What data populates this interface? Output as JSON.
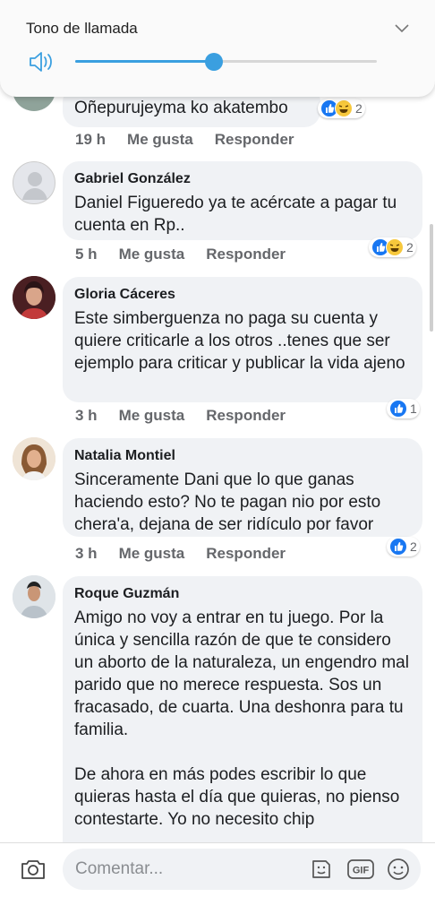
{
  "volume_panel": {
    "title": "Tono de llamada",
    "level_percent": 46
  },
  "comments": [
    {
      "author": "",
      "text": "Oñepurujeyma ko akatembo",
      "time": "19 h",
      "like_label": "Me gusta",
      "reply_label": "Responder",
      "reactions": [
        "like",
        "haha"
      ],
      "reaction_count": "2"
    },
    {
      "author": "Gabriel González",
      "text": "Daniel Figueredo ya te acércate a pagar tu cuenta en Rp..",
      "time": "5 h",
      "like_label": "Me gusta",
      "reply_label": "Responder",
      "reactions": [
        "like",
        "haha"
      ],
      "reaction_count": "2"
    },
    {
      "author": "Gloria Cáceres",
      "text": "Este simberguenza no paga su cuenta y quiere criticarle a los otros ..tenes que ser ejemplo para criticar y publicar la vida ajeno",
      "time": "3 h",
      "like_label": "Me gusta",
      "reply_label": "Responder",
      "reactions": [
        "like"
      ],
      "reaction_count": "1"
    },
    {
      "author": "Natalia Montiel",
      "text": "Sinceramente Dani que lo que ganas haciendo esto? No te pagan nio por esto chera'a, dejana de ser ridículo por favor",
      "time": "3 h",
      "like_label": "Me gusta",
      "reply_label": "Responder",
      "reactions": [
        "like"
      ],
      "reaction_count": "2"
    },
    {
      "author": "Roque Guzmán",
      "text": "Amigo no voy a entrar en tu juego. Por la única y sencilla razón de que te considero un aborto de la naturaleza, un engendro mal parido que no merece respuesta. Sos un fracasado, de cuarta. Una deshonra para tu familia.\n\nDe ahora en más podes escribir lo que quieras hasta el día que quieras, no pienso contestarte.  Yo no necesito chip"
    }
  ],
  "composer": {
    "placeholder": "Comentar...",
    "icons": [
      "camera-icon",
      "sticker-icon",
      "gif-icon",
      "emoji-icon"
    ],
    "gif_label": "GIF"
  },
  "colors": {
    "accent": "#3a9fe0",
    "like": "#1877f2",
    "bubble": "#f0f2f5"
  }
}
